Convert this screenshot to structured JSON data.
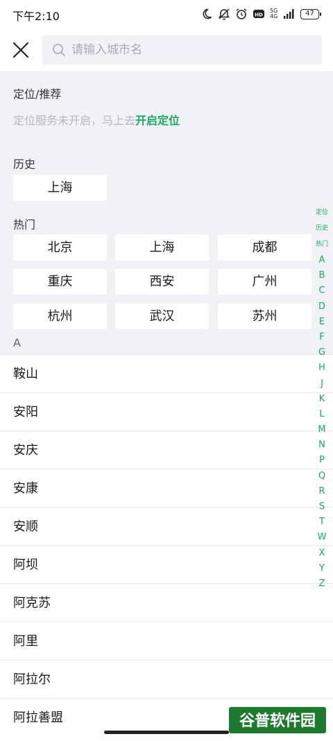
{
  "status": {
    "time": "下午2:10",
    "net_top": "5G",
    "net_bottom": "4G",
    "battery": "47"
  },
  "search": {
    "placeholder": "请输入城市名"
  },
  "location": {
    "title": "定位/推荐",
    "message": "定位服务未开启，马上去",
    "link": "开启定位"
  },
  "history": {
    "title": "历史",
    "cities": [
      "上海"
    ]
  },
  "hot": {
    "title": "热门",
    "cities": [
      "北京",
      "上海",
      "成都",
      "重庆",
      "西安",
      "广州",
      "杭州",
      "武汉",
      "苏州"
    ]
  },
  "list": {
    "header": "A",
    "cities": [
      "鞍山",
      "安阳",
      "安庆",
      "安康",
      "安顺",
      "阿坝",
      "阿克苏",
      "阿里",
      "阿拉尔",
      "阿拉善盟"
    ]
  },
  "index": {
    "top": [
      "定位",
      "历史",
      "热门"
    ],
    "letters": [
      "A",
      "B",
      "C",
      "D",
      "E",
      "F",
      "G",
      "H",
      "J",
      "K",
      "L",
      "M",
      "N",
      "P",
      "Q",
      "R",
      "S",
      "T",
      "W",
      "X",
      "Y",
      "Z"
    ]
  },
  "watermark": {
    "text": "谷普软件园"
  },
  "colors": {
    "accent": "#1aaa62",
    "background": "#f1f2f6"
  }
}
